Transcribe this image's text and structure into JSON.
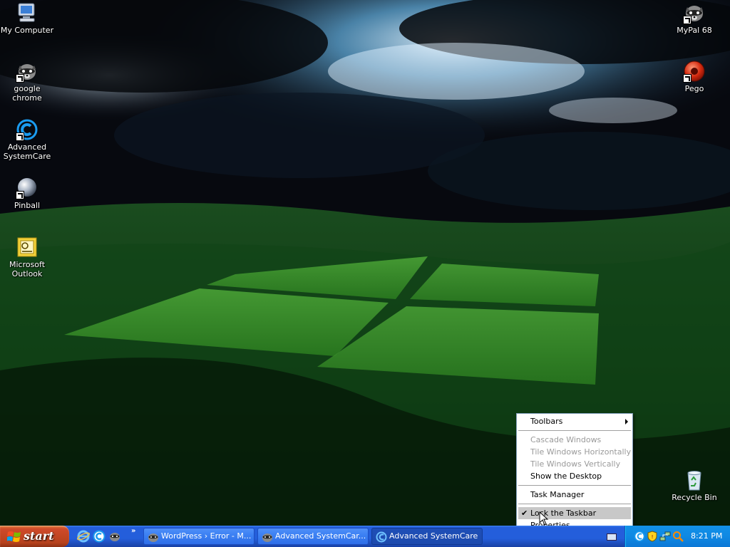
{
  "desktop": {
    "icons_left": [
      {
        "label": "My Computer",
        "icon": "my-computer-icon"
      },
      {
        "label": "google chrome",
        "icon": "raccoon-icon"
      },
      {
        "label": "Advanced SystemCare",
        "icon": "systemcare-icon"
      },
      {
        "label": "Pinball",
        "icon": "pinball-icon"
      },
      {
        "label": "Microsoft Outlook",
        "icon": "outlook-icon"
      }
    ],
    "icons_right": [
      {
        "label": "MyPal 68",
        "icon": "raccoon-icon"
      },
      {
        "label": "Pego",
        "icon": "pego-icon"
      },
      {
        "label": "Recycle Bin",
        "icon": "recycle-bin-icon"
      }
    ]
  },
  "context_menu": {
    "items": [
      {
        "label": "Toolbars",
        "submenu": true,
        "enabled": true
      },
      {
        "label": "Cascade Windows",
        "enabled": false
      },
      {
        "label": "Tile Windows Horizontally",
        "enabled": false
      },
      {
        "label": "Tile Windows Vertically",
        "enabled": false
      },
      {
        "label": "Show the Desktop",
        "enabled": true
      },
      {
        "label": "Task Manager",
        "enabled": true
      },
      {
        "label": "Lock the Taskbar",
        "enabled": true,
        "checked": true,
        "highlighted": true
      },
      {
        "label": "Properties",
        "enabled": true
      }
    ]
  },
  "taskbar": {
    "start_label": "start",
    "quick_launch": [
      "internet-explorer-icon",
      "systemcare-icon",
      "raccoon-icon"
    ],
    "quick_launch_more": "»",
    "tasks": [
      {
        "label": "WordPress › Error - M...",
        "icon": "raccoon-icon",
        "active": false
      },
      {
        "label": "Advanced SystemCar...",
        "icon": "raccoon-icon",
        "active": false
      },
      {
        "label": "Advanced SystemCare",
        "icon": "systemcare-icon",
        "active": true
      }
    ],
    "tray_icons": [
      "systemcare-tray-icon",
      "security-shield-icon",
      "network-icon",
      "search-icon"
    ],
    "clock": "8:21 PM"
  },
  "colors": {
    "taskbar_blue": "#245edb",
    "start_green_red": "#b7421d",
    "tray_blue": "#0f89e3",
    "menu_highlight": "#c8c8c8"
  }
}
